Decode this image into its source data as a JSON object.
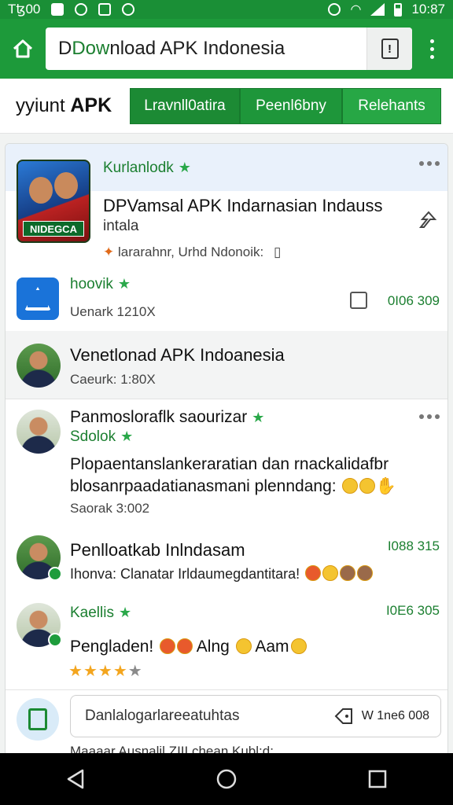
{
  "status_bar": {
    "left_text": "Tꜩ00",
    "time": "10:87",
    "icons": [
      "photo-icon",
      "signal-icon",
      "image-icon",
      "shield-icon",
      "alarm-icon",
      "wifi-icon",
      "cell-signal-icon",
      "battery-icon"
    ]
  },
  "browser": {
    "url_text_green": "Dow",
    "url_text_rest": "nload APK Indonesia",
    "url_prefix_dark": "D",
    "page_action": "!",
    "accent": "#1d9a3a"
  },
  "tabs": {
    "brand_prefix": "yyiunt",
    "brand_bold": "APK",
    "items": [
      {
        "label": "Lravnll0atira"
      },
      {
        "label": "Peenl6bny"
      },
      {
        "label": "Relehants"
      }
    ]
  },
  "feed": {
    "post1": {
      "user": "Kurlanlodk",
      "thumb_label": "NIDEGCA",
      "title": "DPVamsal APK Indarnasian Indauss",
      "subtitle": "intala",
      "meta": "lararahnr, Urhd Ndonoik:"
    },
    "post2": {
      "user": "hoovik",
      "meta": "Uenark  1210X",
      "count": "0I06 309"
    },
    "post3": {
      "title": "Venetlonad APK Indoanesia",
      "meta": "Caeurk:  1:80X"
    },
    "post4": {
      "title": "Panmosloraflk saourizar",
      "user": "Sdolok",
      "body_line1": "Plopaentanslankeraratian dan rnackalidafbr",
      "body_line2": "blosanrpaadatianasmani plenndang:",
      "meta": "Saorak  3:002"
    },
    "post5": {
      "title": "Penlloatkab Inlndasam",
      "count": "I088 315",
      "body": "Ihonva: Clanatar Irldaumegdantitara!"
    },
    "post6": {
      "user": "Kaellis",
      "count": "I0E6 305",
      "body_a": "Pengladen!",
      "body_b": "Alng",
      "body_c": "Aam",
      "rating": 4,
      "rating_max": 5
    },
    "compose": {
      "placeholder": "Danlalogarlareeatuhtas",
      "right_text": "W 1ne6 008",
      "peek": "Maaaar Ausnalil ZIII chean Kubl:d:"
    }
  }
}
